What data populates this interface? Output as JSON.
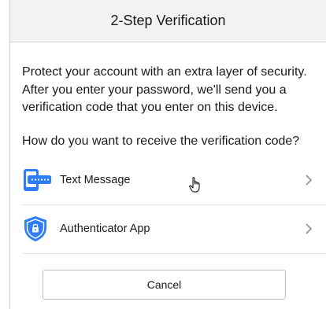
{
  "header": {
    "title": "2-Step Verification"
  },
  "intro_text": "Protect your account with an extra layer of security. After you enter your password, we'll send you a verification code that you enter on this device.",
  "question": "How do you want to receive the verification code?",
  "options": [
    {
      "label": "Text Message",
      "icon": "phone-sms-icon"
    },
    {
      "label": "Authenticator App",
      "icon": "shield-lock-icon"
    }
  ],
  "cancel_label": "Cancel",
  "colors": {
    "accent_blue": "#2f7df6",
    "header_bg": "#f2f2f2",
    "chevron": "#8e8e93"
  }
}
